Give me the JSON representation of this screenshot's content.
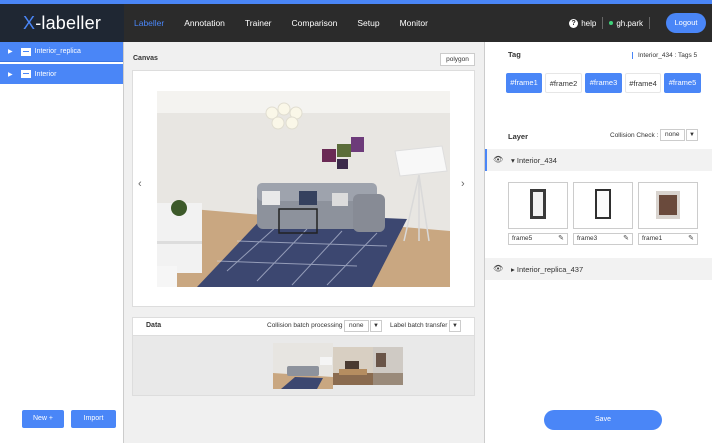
{
  "app": {
    "logo_prefix": "X",
    "logo_rest": "-labeller"
  },
  "nav": [
    "Labeller",
    "Annotation",
    "Trainer",
    "Comparison",
    "Setup",
    "Monitor"
  ],
  "header": {
    "help": "help",
    "user": "gh.park",
    "logout": "Logout"
  },
  "sidebar": {
    "items": [
      {
        "label": "Interior_replica"
      },
      {
        "label": "Interior"
      }
    ],
    "new_label": "New +",
    "import_label": "Import"
  },
  "canvas": {
    "label": "Canvas",
    "mode": "polygon"
  },
  "data_panel": {
    "label": "Data",
    "collision_label": "Collision batch processing :",
    "collision_value": "none",
    "label_transfer": "Label batch transfer"
  },
  "tag": {
    "label": "Tag",
    "info": "Interior_434 : Tags 5",
    "tags": [
      {
        "label": "#frame1",
        "selected": true
      },
      {
        "label": "#frame2",
        "selected": false
      },
      {
        "label": "#frame3",
        "selected": true
      },
      {
        "label": "#frame4",
        "selected": false
      },
      {
        "label": "#frame5",
        "selected": true
      }
    ]
  },
  "layer": {
    "label": "Layer",
    "collision_label": "Collision Check :",
    "collision_value": "none",
    "items": [
      {
        "name": "Interior_434",
        "expanded": true,
        "frames": [
          {
            "name": "frame5"
          },
          {
            "name": "frame3"
          },
          {
            "name": "frame1"
          }
        ]
      },
      {
        "name": "Interior_replica_437",
        "expanded": false
      }
    ]
  },
  "save_label": "Save",
  "icons": {
    "eye": "eye-icon",
    "pencil": "pencil-icon",
    "folder": "folder-icon"
  },
  "colors": {
    "accent": "#4a86f7",
    "topbar": "#2b2b2b"
  }
}
